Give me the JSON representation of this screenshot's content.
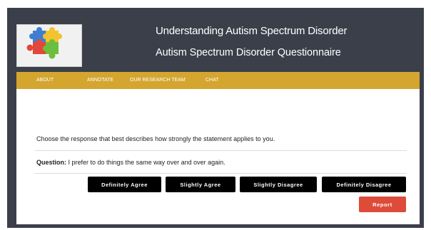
{
  "header": {
    "logo_icon": "puzzle-pieces-logo",
    "title": "Understanding Autism Spectrum Disorder",
    "subtitle": "Autism Spectrum Disorder Questionnaire"
  },
  "nav": {
    "items": [
      {
        "label": "ABOUT"
      },
      {
        "label": "ANNOTATE"
      },
      {
        "label": "OUR RESEARCH TEAM"
      },
      {
        "label": "CHAT"
      }
    ]
  },
  "questionnaire": {
    "instruction": "Choose the response that best describes how strongly the statement applies to you.",
    "question_label": "Question:",
    "question_text": "I prefer to do things the same way over and over again.",
    "answers": [
      {
        "label": "Definitely Agree"
      },
      {
        "label": "Slightly Agree"
      },
      {
        "label": "Slightly Disagree"
      },
      {
        "label": "Definitely Disagree"
      }
    ],
    "report_label": "Report"
  },
  "colors": {
    "frame_bg": "#3a3f4a",
    "nav_bg": "#d4a52f",
    "answer_btn_bg": "#000000",
    "report_btn_bg": "#dd4b39",
    "puzzle_colors": [
      "#3f7fd0",
      "#f2c32e",
      "#e2473b",
      "#6cbf3c"
    ]
  }
}
